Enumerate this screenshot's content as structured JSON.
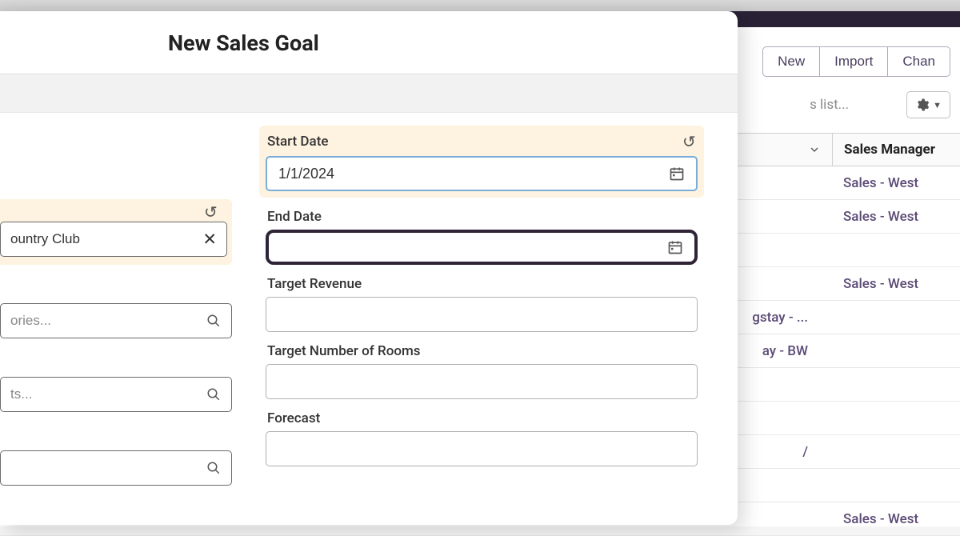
{
  "modal": {
    "title": "New Sales Goal",
    "fields": {
      "start_date": {
        "label": "Start Date",
        "value": "1/1/2024"
      },
      "end_date": {
        "label": "End Date",
        "value": ""
      },
      "target_revenue": {
        "label": "Target Revenue",
        "value": ""
      },
      "target_rooms": {
        "label": "Target Number of Rooms",
        "value": ""
      },
      "forecast": {
        "label": "Forecast",
        "value": ""
      }
    },
    "left_inputs": {
      "lookup": "ountry Club",
      "categories_placeholder": "ories...",
      "accounts_placeholder": "ts..."
    }
  },
  "background": {
    "buttons": {
      "new": "New",
      "import": "Import",
      "change": "Chan"
    },
    "search_placeholder": "s list...",
    "table": {
      "header": "Sales Manager",
      "rows": [
        {
          "left": "",
          "right": "Sales - West"
        },
        {
          "left": "",
          "right": "Sales - West"
        },
        {
          "left": "",
          "right": ""
        },
        {
          "left": "",
          "right": "Sales - West"
        },
        {
          "left": "gstay - ...",
          "right": ""
        },
        {
          "left": "ay - BW",
          "right": ""
        },
        {
          "left": "",
          "right": ""
        },
        {
          "left": "",
          "right": ""
        },
        {
          "left": "/",
          "right": ""
        },
        {
          "left": "",
          "right": ""
        },
        {
          "left": "",
          "right": "Sales - West"
        }
      ]
    }
  }
}
